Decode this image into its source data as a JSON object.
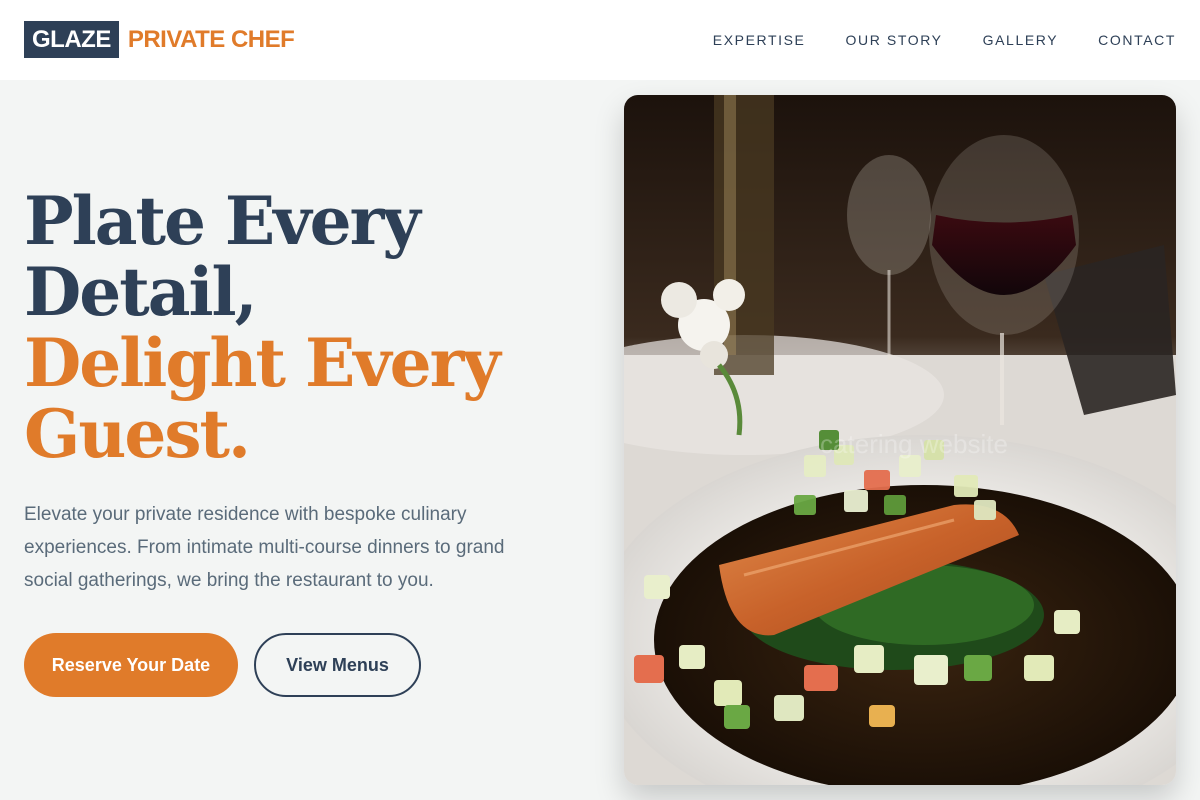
{
  "brand": {
    "box_text": "GLAZE",
    "name": "PRIVATE CHEF",
    "colors": {
      "primary": "#2e4057",
      "accent": "#e07b2a",
      "background": "#f3f5f4"
    }
  },
  "nav": {
    "items": [
      {
        "label": "EXPERTISE"
      },
      {
        "label": "OUR STORY"
      },
      {
        "label": "GALLERY"
      },
      {
        "label": "CONTACT"
      }
    ]
  },
  "hero": {
    "headline_dark": [
      "Plate Every",
      "Detail,"
    ],
    "headline_accent": [
      "Delight Every",
      "Guest."
    ],
    "lead": "Elevate your private residence with bespoke culinary experiences. From intimate multi-course dinners to grand social gatherings, we bring the restaurant to you.",
    "primary_button": "Reserve Your Date",
    "secondary_button": "View Menus",
    "image_subject": "plated seared salmon with vegetable salsa and wine glasses",
    "image_watermark": "catering website"
  }
}
